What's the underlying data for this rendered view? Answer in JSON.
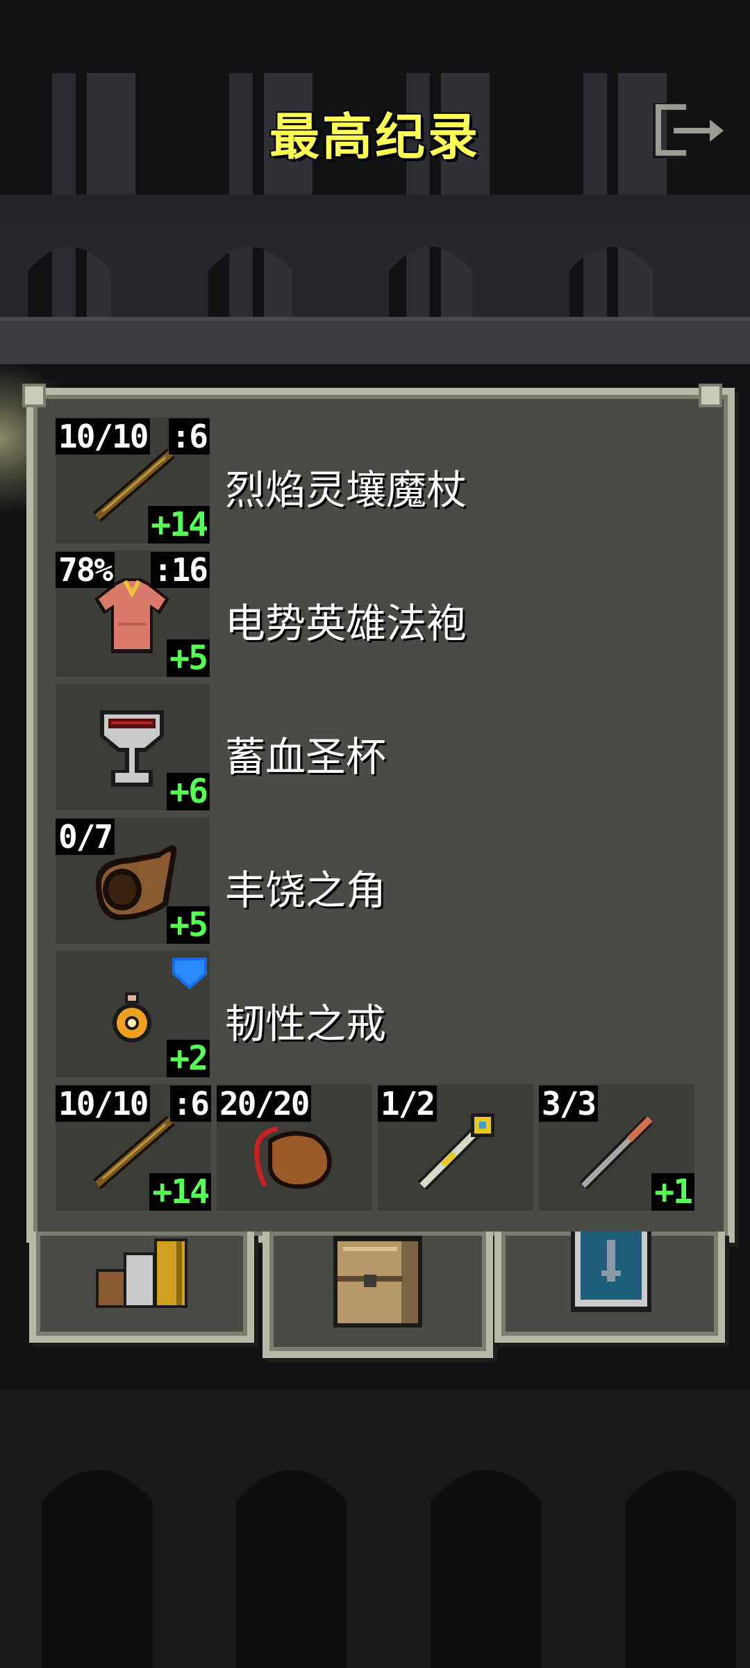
{
  "header": {
    "title": "最高纪录",
    "exit_icon": "exit-icon"
  },
  "items": [
    {
      "name": "烈焰灵壤魔杖",
      "charges": "10/10",
      "bonus": ":6",
      "level": "+14",
      "icon": "wand-icon"
    },
    {
      "name": "电势英雄法袍",
      "charges": "78%",
      "bonus": ":16",
      "level": "+5",
      "icon": "robe-icon"
    },
    {
      "name": "蓄血圣杯",
      "charges": "",
      "bonus": "",
      "level": "+6",
      "icon": "chalice-icon"
    },
    {
      "name": "丰饶之角",
      "charges": "0/7",
      "bonus": "",
      "level": "+5",
      "icon": "horn-icon"
    },
    {
      "name": "韧性之戒",
      "charges": "",
      "bonus": "",
      "level": "+2",
      "icon": "ring-icon",
      "marker": "known-marker-icon"
    }
  ],
  "quickslots": [
    {
      "charges": "10/10",
      "bonus": ":6",
      "level": "+14",
      "icon": "wand-icon"
    },
    {
      "charges": "20/20",
      "bonus": "",
      "level": "",
      "icon": "waterskin-icon"
    },
    {
      "charges": "1/2",
      "bonus": "",
      "level": "",
      "icon": "scepter-icon"
    },
    {
      "charges": "3/3",
      "bonus": "",
      "level": "+1",
      "icon": "dart-icon"
    }
  ],
  "tabs": [
    {
      "icon": "stats-books-icon"
    },
    {
      "icon": "backpack-icon"
    },
    {
      "icon": "badges-icon"
    }
  ]
}
